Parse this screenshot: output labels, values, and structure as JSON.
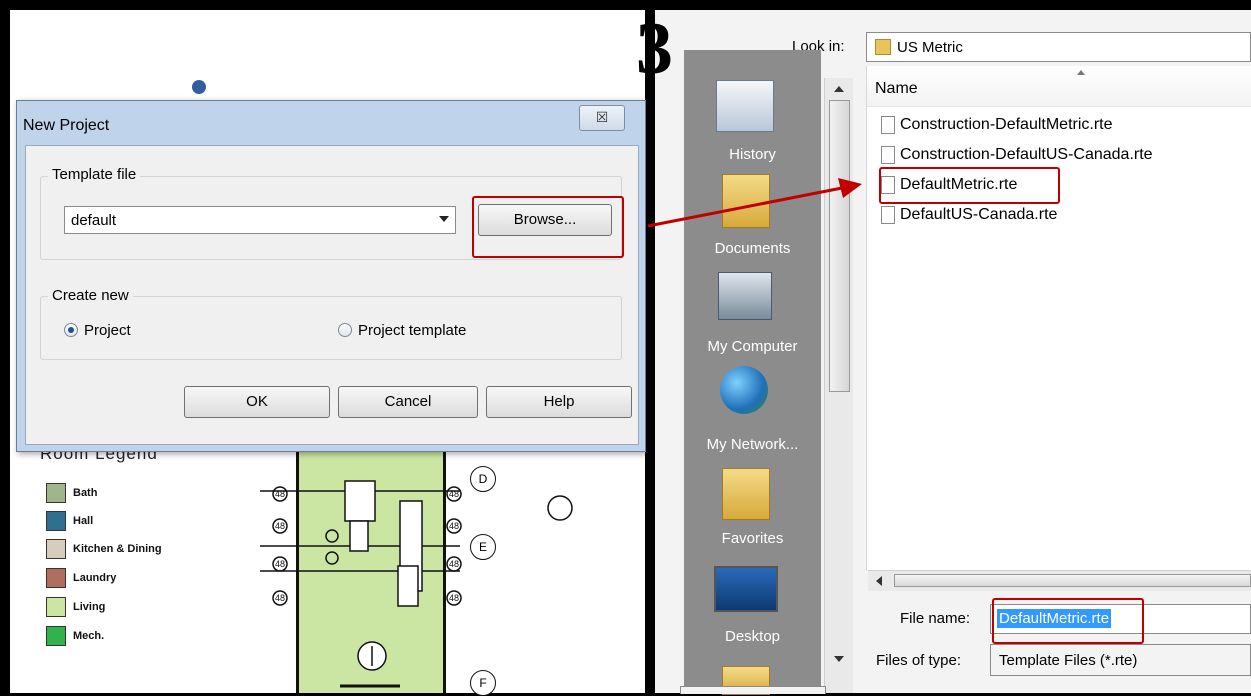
{
  "step_number": "3",
  "new_project_dialog": {
    "title": "New Project",
    "close_glyph": "☒",
    "template_group_label": "Template file",
    "template_value": "default",
    "browse_label": "Browse...",
    "create_new_label": "Create new",
    "radio_project_label": "Project",
    "radio_template_label": "Project template",
    "ok_label": "OK",
    "cancel_label": "Cancel",
    "help_label": "Help"
  },
  "background_drawing": {
    "legend_title": "Room Legend",
    "legend_items": [
      {
        "label": "Bath",
        "color": "#9fb68a"
      },
      {
        "label": "Hall",
        "color": "#2f6f8f"
      },
      {
        "label": "Kitchen & Dining",
        "color": "#d6cdbf"
      },
      {
        "label": "Laundry",
        "color": "#b06f5e"
      },
      {
        "label": "Living",
        "color": "#cbe6a3"
      },
      {
        "label": "Mech.",
        "color": "#2fb34a"
      }
    ],
    "grid_bubbles": [
      "D",
      "E",
      "F"
    ]
  },
  "open_dialog": {
    "look_in_label": "Look in:",
    "look_in_value": "US Metric",
    "places": [
      {
        "label": "History",
        "icon": "history-icon"
      },
      {
        "label": "Documents",
        "icon": "documents-folder-icon"
      },
      {
        "label": "My Computer",
        "icon": "my-computer-icon"
      },
      {
        "label": "My Network...",
        "icon": "network-globe-icon"
      },
      {
        "label": "Favorites",
        "icon": "favorites-folder-icon"
      },
      {
        "label": "Desktop",
        "icon": "desktop-icon"
      }
    ],
    "column_header": "Name",
    "files": [
      "Construction-DefaultMetric.rte",
      "Construction-DefaultUS-Canada.rte",
      "DefaultMetric.rte",
      "DefaultUS-Canada.rte"
    ],
    "selected_file": "DefaultMetric.rte",
    "file_name_label": "File name:",
    "file_name_value": "DefaultMetric.rte",
    "files_of_type_label": "Files of type:",
    "files_of_type_value": "Template Files  (*.rte)"
  },
  "colors": {
    "highlight": "#c00000",
    "arrow": "#c00000",
    "selection": "#3399ff"
  }
}
